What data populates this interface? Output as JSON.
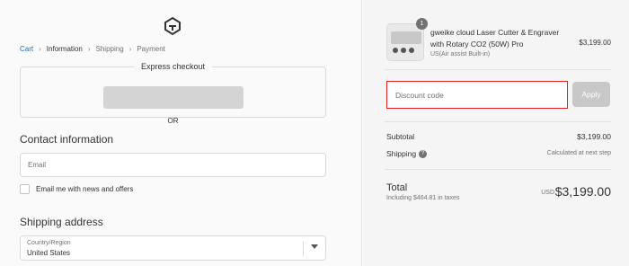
{
  "breadcrumb": {
    "cart": "Cart",
    "information": "Information",
    "shipping": "Shipping",
    "payment": "Payment"
  },
  "express_checkout": {
    "title": "Express checkout",
    "divider": "OR"
  },
  "contact": {
    "title": "Contact information",
    "email_placeholder": "Email",
    "newsletter_label": "Email me with news and offers"
  },
  "shipping": {
    "title": "Shipping address",
    "country_label": "Country/Region",
    "country_value": "United States"
  },
  "cart": {
    "item_count": "1",
    "product_name": "gweike cloud Laser Cutter & Engraver with Rotary CO2 (50W) Pro",
    "variant": "US(Air assist Built-in)",
    "price": "$3,199.00"
  },
  "discount": {
    "placeholder": "Discount code",
    "apply_label": "Apply",
    "highlight_color": "#e22120"
  },
  "summary": {
    "subtotal_label": "Subtotal",
    "subtotal_value": "$3,199.00",
    "shipping_label": "Shipping",
    "shipping_value": "Calculated at next step",
    "total_label": "Total",
    "tax_note": "Including $464.81 in taxes",
    "currency": "USD",
    "total_value": "$3,199.00"
  },
  "icons": {
    "logo": "gweike-logo-icon",
    "chevron": "chevron-right-icon",
    "help": "question-circle-icon",
    "select_arrow": "chevron-down-icon"
  },
  "colors": {
    "link": "#1f6fb2",
    "apply_disabled": "#c8c8c8",
    "left_bg": "#fafafa",
    "right_bg": "#f5f5f5"
  }
}
